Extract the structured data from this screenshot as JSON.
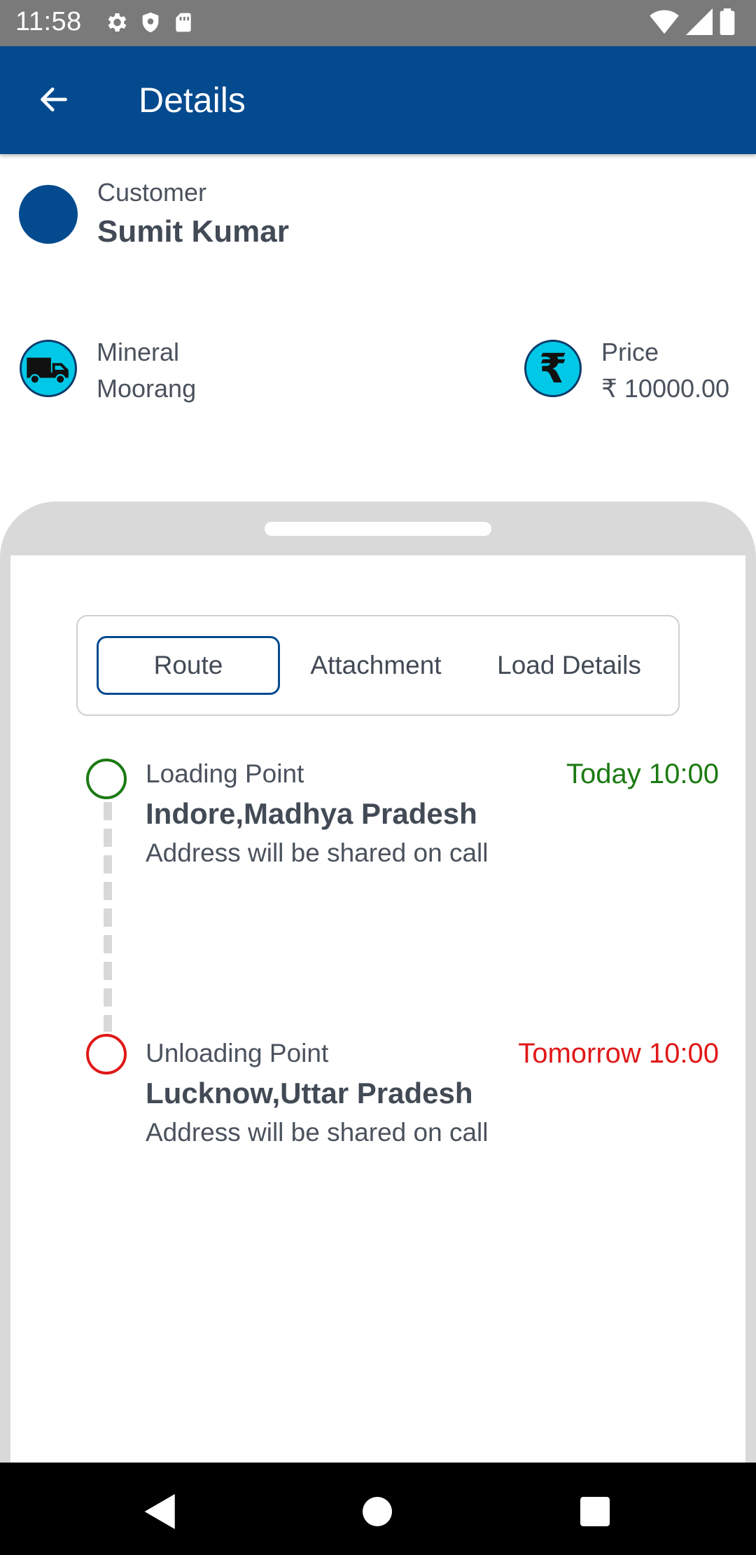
{
  "status_bar": {
    "time": "11:58"
  },
  "app_bar": {
    "title": "Details"
  },
  "customer": {
    "label": "Customer",
    "name": "Sumit Kumar"
  },
  "mineral": {
    "label": "Mineral",
    "value": "Moorang"
  },
  "price": {
    "label": "Price",
    "value": "₹ 10000.00",
    "icon_glyph": "₹"
  },
  "tabs": [
    {
      "label": "Route",
      "selected": true
    },
    {
      "label": "Attachment",
      "selected": false
    },
    {
      "label": "Load Details",
      "selected": false
    }
  ],
  "route": {
    "loading": {
      "label": "Loading Point",
      "city": "Indore,Madhya Pradesh",
      "address": "Address will be shared on call",
      "time": "Today 10:00",
      "color": "#1b7a12"
    },
    "unloading": {
      "label": "Unloading Point",
      "city": "Lucknow,Uttar Pradesh",
      "address": "Address will be shared on call",
      "time": "Tomorrow 10:00",
      "color": "#e01818"
    }
  },
  "colors": {
    "primary": "#044a8f",
    "icon_bg": "#00c8e6"
  }
}
